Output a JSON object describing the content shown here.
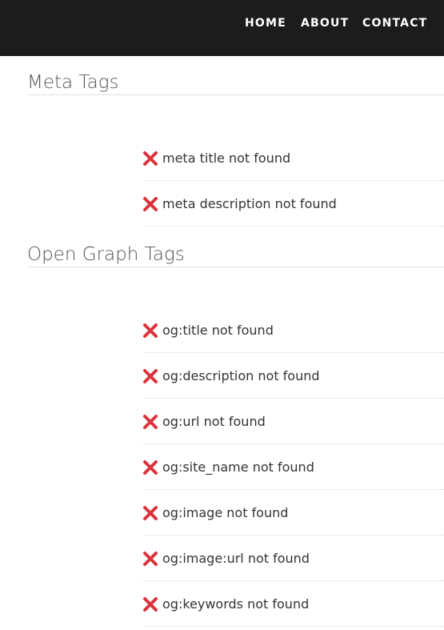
{
  "nav": {
    "home": "HOME",
    "about": "ABOUT",
    "contact": "CONTACT"
  },
  "sections": {
    "meta": {
      "title": "Meta Tags",
      "items": [
        "meta title not found",
        "meta description not found"
      ]
    },
    "open_graph": {
      "title": "Open Graph Tags",
      "items": [
        "og:title not found",
        "og:description not found",
        "og:url not found",
        "og:site_name not found",
        "og:image not found",
        "og:image:url not found",
        "og:keywords not found"
      ]
    }
  },
  "colors": {
    "navbar_bg": "#1c1c1c",
    "error_icon": "#d9343d"
  },
  "icons": {
    "status": "cross-mark-icon"
  }
}
